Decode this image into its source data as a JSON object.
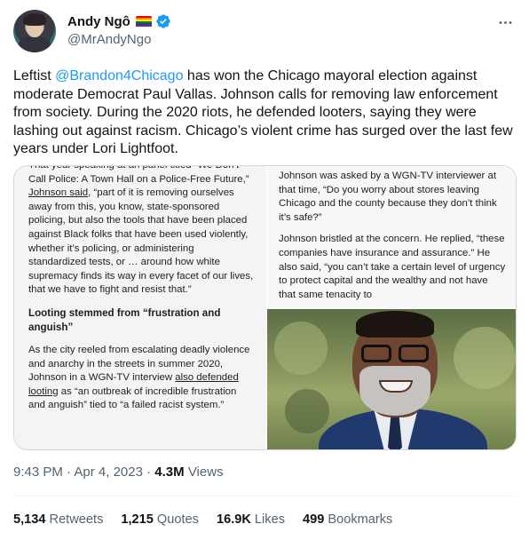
{
  "author": {
    "name": "Andy Ngô",
    "handle": "@MrAndyNgo"
  },
  "tweet": {
    "prefix": "Leftist ",
    "mention": "@Brandon4Chicago",
    "body": " has won the Chicago mayoral election against moderate Democrat Paul Vallas. Johnson calls for removing law enforcement from society. During the 2020 riots, he defended looters, saying they were lashing out against racism. Chicago’s violent crime has surged over the last few years under Lori Lightfoot."
  },
  "article_left": {
    "p1_a": "That year speaking at an panel titled “We Don’t Call Police: A Town Hall on a Police-Free Future,” ",
    "p1_link": "Johnson said",
    "p1_b": ", “part of it is removing ourselves away from this, you know, state-sponsored policing, but also the tools that have been placed against Black folks that have been used violently, whether it’s policing, or administering standardized tests, or … around how white supremacy finds its way in every facet of our lives, that we have to fight and resist that.”",
    "heading": "Looting stemmed from “frustration and anguish”",
    "p2_a": "As the city reeled from escalating deadly violence and anarchy in the streets in summer 2020, Johnson in a WGN-TV interview ",
    "p2_link": "also defended looting",
    "p2_b": " as “an outbreak of incredible frustration and anguish” tied to “a failed racist system.”"
  },
  "article_right": {
    "p1": "Johnson was asked by a WGN-TV interviewer at that time, “Do you worry about stores leaving Chicago and the county because they don’t think it’s safe?”",
    "p2": "Johnson bristled at the concern. He replied, “these companies have insurance and assurance.” He also said, “you can’t take a certain level of urgency to protect capital and the wealthy and not have that same tenacity to"
  },
  "meta": {
    "time": "9:43 PM",
    "sep1": " · ",
    "date": "Apr 4, 2023",
    "sep2": " · ",
    "views_count": "4.3M",
    "views_label": " Views"
  },
  "stats": {
    "retweets_count": "5,134",
    "retweets_label": "Retweets",
    "quotes_count": "1,215",
    "quotes_label": "Quotes",
    "likes_count": "16.9K",
    "likes_label": "Likes",
    "bookmarks_count": "499",
    "bookmarks_label": "Bookmarks"
  },
  "colors": {
    "accent": "#1d9bf0",
    "text": "#0f1419",
    "muted": "#536471",
    "verified": "#1d9bf0"
  },
  "icons": {
    "verified": "verified-badge-icon",
    "more": "more-horizontal-icon",
    "flag": "rainbow-flag-icon"
  }
}
